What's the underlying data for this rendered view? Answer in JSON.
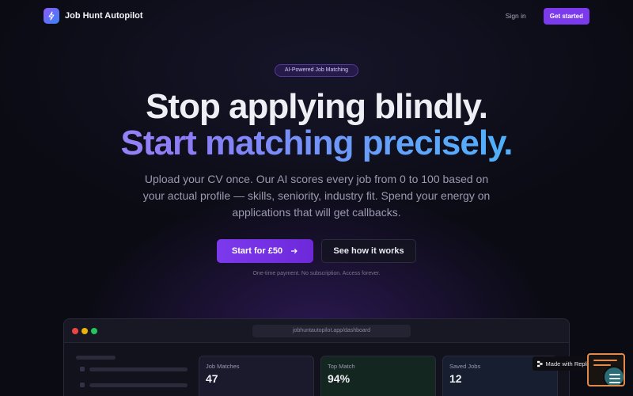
{
  "nav": {
    "brand": "Job Hunt Autopilot",
    "signin": "Sign in",
    "get_started": "Get started"
  },
  "hero": {
    "badge": "AI-Powered Job Matching",
    "headline_1": "Stop applying blindly.",
    "headline_2": "Start matching precisely.",
    "subtitle": "Upload your CV once. Our AI scores every job from 0 to 100 based on your actual profile — skills, seniority, industry fit. Spend your energy on applications that will get callbacks.",
    "cta_primary": "Start for £50",
    "cta_primary_icon": "arrow-right-icon",
    "cta_secondary": "See how it works",
    "fine_print": "One-time payment. No subscription. Access forever."
  },
  "preview": {
    "url": "jobhuntautopilot.app/dashboard",
    "stats": [
      {
        "label": "Job Matches",
        "value": "47",
        "tint": "#1a1a2c"
      },
      {
        "label": "Top Match",
        "value": "94%",
        "tint": "#13261f"
      },
      {
        "label": "Saved Jobs",
        "value": "12",
        "tint": "#161e30"
      }
    ],
    "traffic_lights": [
      "#ef4444",
      "#eab308",
      "#22c55e"
    ]
  },
  "replit_badge": {
    "label": "Made with Replit"
  },
  "colors": {
    "accent": "#7c3aed",
    "gradient_start": "#a78bfa",
    "gradient_end": "#38bdf8"
  }
}
